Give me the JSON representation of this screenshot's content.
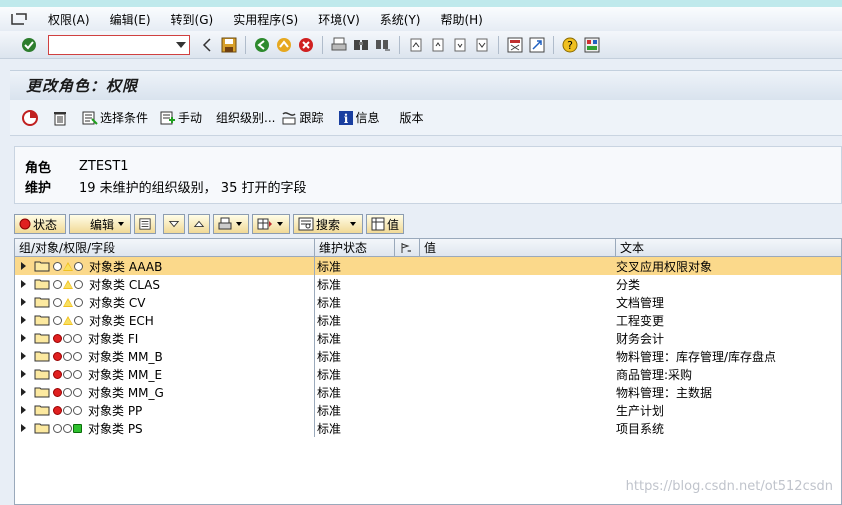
{
  "menu": [
    "权限(A)",
    "编辑(E)",
    "转到(G)",
    "实用程序(S)",
    "环境(V)",
    "系统(Y)",
    "帮助(H)"
  ],
  "command_field": {
    "value": ""
  },
  "title": "更改角色：权限",
  "app_toolbar": {
    "select_criteria": "选择条件",
    "manual": "手动",
    "org_levels": "组织级别...",
    "trace": "跟踪",
    "info": "信息",
    "version": "版本"
  },
  "role": {
    "label": "角色",
    "value": "ZTEST1",
    "maint_label": "维护",
    "maint_value": "19 未维护的组织级别， 35 打开的字段"
  },
  "tree_toolbar": {
    "status": "状态",
    "edit": "编辑",
    "search": "搜索",
    "value": "值"
  },
  "columns": [
    "组/对象/权限/字段",
    "维护状态",
    "",
    "值",
    "文本"
  ],
  "rows": [
    {
      "name": "对象类 AAAB",
      "status": "标准",
      "text": "交叉应用权限对象",
      "lights": [
        "off",
        "yellow",
        "off"
      ],
      "selected": true
    },
    {
      "name": "对象类 CLAS",
      "status": "标准",
      "text": "分类",
      "lights": [
        "off",
        "yellow",
        "off"
      ]
    },
    {
      "name": "对象类 CV",
      "status": "标准",
      "text": "文档管理",
      "lights": [
        "off",
        "yellow",
        "off"
      ]
    },
    {
      "name": "对象类 ECH",
      "status": "标准",
      "text": "工程变更",
      "lights": [
        "off",
        "yellow",
        "off"
      ]
    },
    {
      "name": "对象类 FI",
      "status": "标准",
      "text": "财务会计",
      "lights": [
        "red",
        "off",
        "off"
      ]
    },
    {
      "name": "对象类 MM_B",
      "status": "标准",
      "text": "物料管理：库存管理/库存盘点",
      "lights": [
        "red",
        "off",
        "off"
      ]
    },
    {
      "name": "对象类 MM_E",
      "status": "标准",
      "text": "商品管理:采购",
      "lights": [
        "red",
        "off",
        "off"
      ]
    },
    {
      "name": "对象类 MM_G",
      "status": "标准",
      "text": "物料管理：主数据",
      "lights": [
        "red",
        "off",
        "off"
      ]
    },
    {
      "name": "对象类 PP",
      "status": "标准",
      "text": "生产计划",
      "lights": [
        "red",
        "off",
        "off"
      ]
    },
    {
      "name": "对象类 PS",
      "status": "标准",
      "text": "项目系统",
      "lights": [
        "off",
        "off",
        "green"
      ]
    }
  ],
  "watermark": "https://blog.csdn.net/ot512csdn"
}
